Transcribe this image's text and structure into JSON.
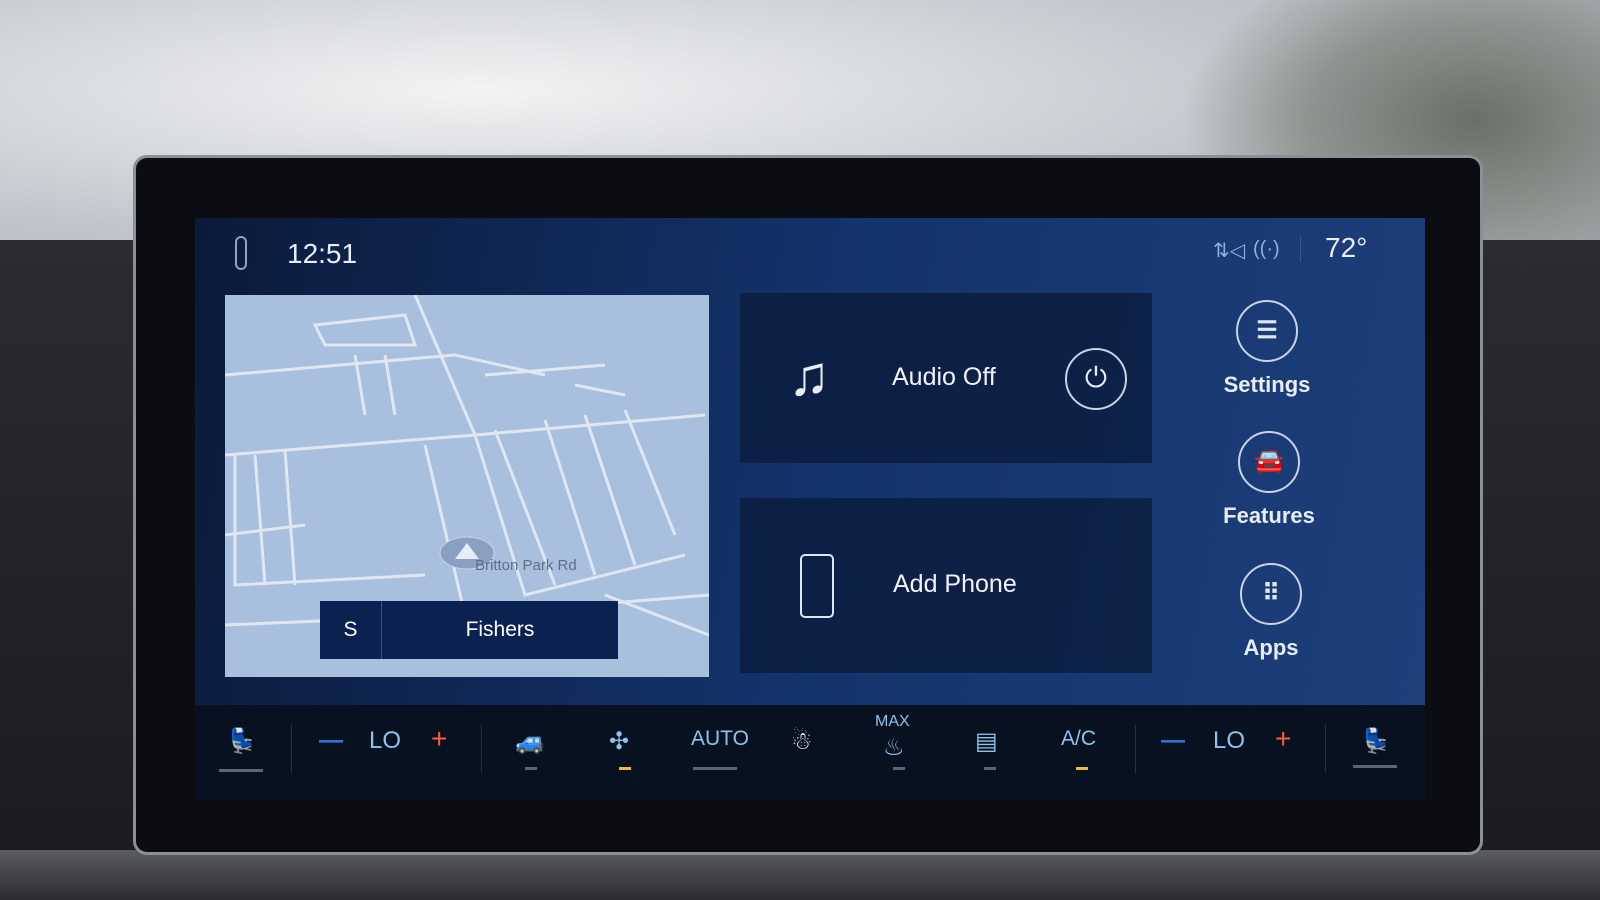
{
  "status_bar": {
    "time": "12:51",
    "temperature": "72°",
    "icons": [
      "lincoln-logo-icon",
      "signal-arrows-icon",
      "wifi-info-icon"
    ]
  },
  "map": {
    "street_label": "Britton Park Rd",
    "nav_direction": "S",
    "nav_city": "Fishers"
  },
  "audio_card": {
    "label": "Audio Off",
    "icon": "music-note-icon",
    "power_icon": "power-icon"
  },
  "phone_card": {
    "label": "Add Phone",
    "icon": "phone-icon"
  },
  "side_menu": [
    {
      "label": "Settings",
      "icon": "sliders-icon"
    },
    {
      "label": "Features",
      "icon": "car-icon"
    },
    {
      "label": "Apps",
      "icon": "grid-icon"
    }
  ],
  "climate": {
    "left_temp": "LO",
    "right_temp": "LO",
    "minus": "—",
    "plus": "+",
    "auto_label": "AUTO",
    "max_label": "MAX",
    "ac_label": "A/C",
    "active_color": "#f0b93a",
    "text_color": "#8ec3ee"
  }
}
